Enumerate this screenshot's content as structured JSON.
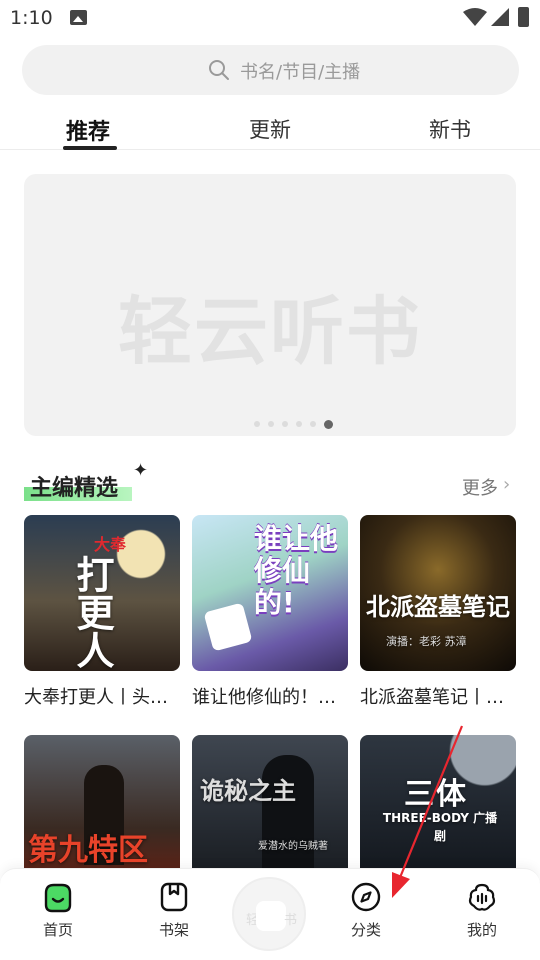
{
  "status_bar": {
    "time": "1:10"
  },
  "search": {
    "placeholder": "书名/节目/主播"
  },
  "tabs": [
    {
      "label": "推荐",
      "active": true
    },
    {
      "label": "更新",
      "active": false
    },
    {
      "label": "新书",
      "active": false
    }
  ],
  "banner": {
    "text": "轻云听书",
    "dot_count": 6,
    "active_dot": 6
  },
  "section": {
    "title": "主编精选",
    "more_label": "更多"
  },
  "books": [
    {
      "title": "大奉打更人丨头…",
      "cover_text": "打更人",
      "cover_sub": "大奉"
    },
    {
      "title": "谁让他修仙的！…",
      "cover_text": "谁让他修仙的!",
      "cover_sub": ""
    },
    {
      "title": "北派盗墓笔记丨…",
      "cover_text": "北派盗墓笔记",
      "cover_sub": "演播：老彩 苏漳"
    },
    {
      "title": "",
      "cover_text": "第九特区",
      "cover_sub": ""
    },
    {
      "title": "",
      "cover_text": "诡秘之主",
      "cover_sub": "爱潜水的乌贼著"
    },
    {
      "title": "",
      "cover_text": "三体",
      "cover_sub": "THREE-BODY 广播剧"
    }
  ],
  "bottom_nav": [
    {
      "label": "首页",
      "icon": "home-icon",
      "active": true
    },
    {
      "label": "书架",
      "icon": "bookshelf-icon",
      "active": false
    },
    {
      "label": "分类",
      "icon": "compass-icon",
      "active": false
    },
    {
      "label": "我的",
      "icon": "profile-icon",
      "active": false
    }
  ],
  "center_button": {
    "label_left": "轻",
    "label_right": "书"
  },
  "colors": {
    "accent_green": "#4cd964",
    "highlight_green": "#7be08a",
    "annotation_red": "#e8262f"
  }
}
